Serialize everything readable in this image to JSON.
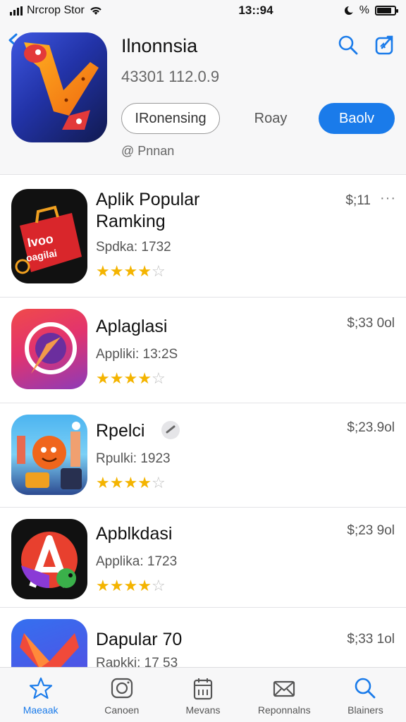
{
  "status": {
    "carrier": "Nrcrop Stor",
    "time": "13::94",
    "battery_text": "%",
    "battery_level": 0.85
  },
  "header": {
    "app_title": "Ilnonnsia",
    "version": "43301 112.0.9",
    "outline_button": "IRonensing",
    "text_button": "Roay",
    "primary_button": "Baolv",
    "developer": "@ Pnnan",
    "accent": "#1a7bea"
  },
  "list": {
    "items": [
      {
        "title_line1": "Aplik Popular",
        "title_line2": "Ramking",
        "subtitle": "Spdka: 1732",
        "rating": 3.5,
        "price": "$;11",
        "more": "···",
        "icon": "shopping-bag-icon"
      },
      {
        "title_line1": "Aplaglasi",
        "title_line2": "",
        "subtitle": "Appliki: 13:2S",
        "rating": 3.5,
        "price": "$;33 0ol",
        "more": "",
        "icon": "camera-ring-icon"
      },
      {
        "title_line1": "Rpelci",
        "title_line2": "",
        "subtitle": "Rpulki: 1923",
        "rating": 4,
        "price": "$;23.9ol",
        "more": "",
        "icon": "cartoon-game-icon"
      },
      {
        "title_line1": "Apblkdasi",
        "title_line2": "",
        "subtitle": "Applika: 1723",
        "rating": 3.5,
        "price": "$;23 9ol",
        "more": "",
        "icon": "letter-a-icon"
      },
      {
        "title_line1": "Dapular 70",
        "title_line2": "",
        "subtitle": "Rapkki: 17 53",
        "rating": 0,
        "price": "$;33 1ol",
        "more": "",
        "icon": "heart-shape-icon"
      }
    ]
  },
  "tabbar": {
    "tabs": [
      {
        "label": "Maeaak",
        "icon": "star-icon"
      },
      {
        "label": "Canoen",
        "icon": "camera-icon"
      },
      {
        "label": "Mevans",
        "icon": "calendar-icon"
      },
      {
        "label": "Reponnalns",
        "icon": "envelope-icon"
      },
      {
        "label": "Blainers",
        "icon": "search-icon"
      }
    ]
  }
}
